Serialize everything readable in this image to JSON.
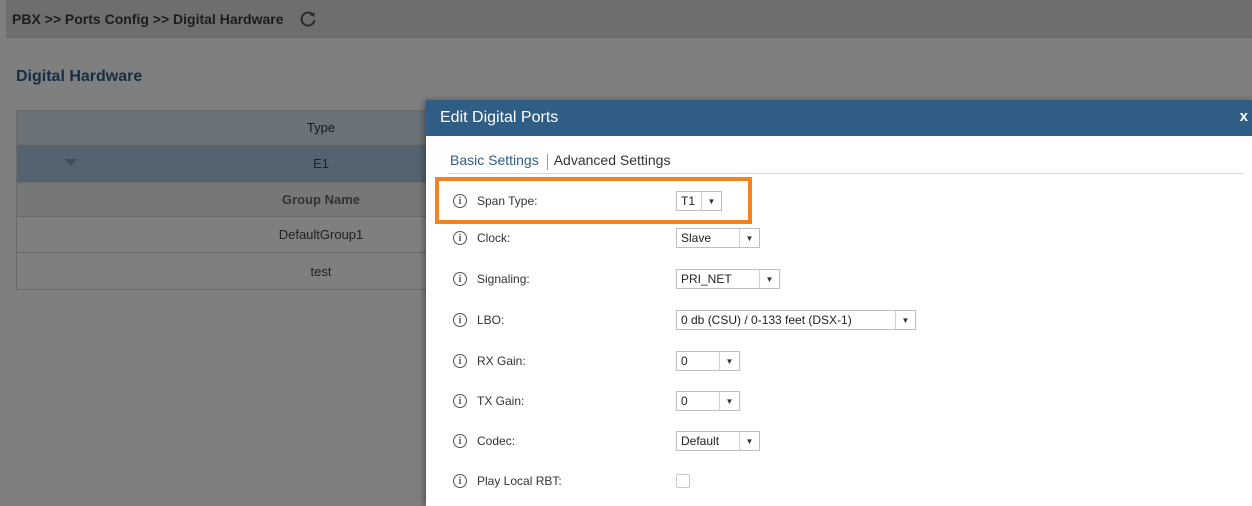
{
  "breadcrumb": "PBX >> Ports Config >> Digital Hardware",
  "icons": {
    "refresh": "refresh-icon",
    "info": "info-icon",
    "close": "close-icon",
    "expand": "triangle-down-icon"
  },
  "page_title": "Digital Hardware",
  "table": {
    "type_header": "Type",
    "type_value": "E1",
    "group_header": "Group Name",
    "groups": [
      "DefaultGroup1",
      "test"
    ]
  },
  "dialog": {
    "title": "Edit Digital Ports",
    "close": "x",
    "tabs": [
      "Basic Settings",
      "Advanced Settings"
    ],
    "fields": {
      "span_type": {
        "label": "Span Type:",
        "value": "T1"
      },
      "clock": {
        "label": "Clock:",
        "value": "Slave"
      },
      "signaling": {
        "label": "Signaling:",
        "value": "PRI_NET"
      },
      "lbo": {
        "label": "LBO:",
        "value": "0 db (CSU) / 0-133 feet (DSX-1)"
      },
      "rx_gain": {
        "label": "RX Gain:",
        "value": "0"
      },
      "tx_gain": {
        "label": "TX Gain:",
        "value": "0"
      },
      "codec": {
        "label": "Codec:",
        "value": "Default"
      },
      "play_local_rbt": {
        "label": "Play Local RBT:",
        "checked": false
      }
    }
  },
  "colors": {
    "header_blue": "#2f5d84",
    "highlight": "#f58220"
  }
}
